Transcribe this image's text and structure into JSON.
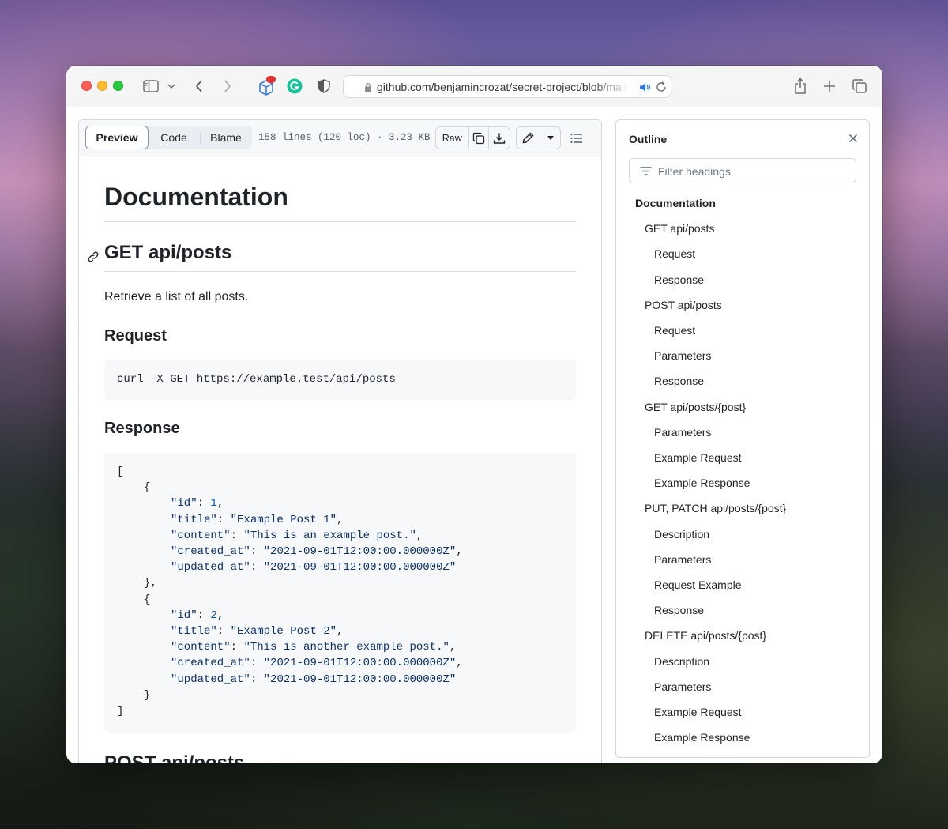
{
  "browser": {
    "url": "github.com/benjamincrozat/secret-project/blob/main",
    "extension_badge_count": "",
    "icons": [
      "sidebar-icon",
      "chevron-down-icon",
      "back-icon",
      "forward-icon",
      "extension-cube-icon",
      "grammarly-icon",
      "privacy-shield-icon",
      "lock-icon",
      "speaker-icon",
      "reload-icon",
      "share-icon",
      "new-tab-icon",
      "tab-overview-icon"
    ]
  },
  "file": {
    "tabs": [
      "Preview",
      "Code",
      "Blame"
    ],
    "active_tab": "Preview",
    "meta": "158 lines (120 loc) · 3.23 KB",
    "raw_label": "Raw"
  },
  "markdown": {
    "h1": "Documentation",
    "section1_title": "GET api/posts",
    "section1_desc": "Retrieve a list of all posts.",
    "request_heading": "Request",
    "request_code": "curl -X GET https://example.test/api/posts",
    "response_heading": "Response",
    "response_code": [
      {
        "indent": 0,
        "parts": [
          {
            "t": "p",
            "v": "["
          }
        ]
      },
      {
        "indent": 1,
        "parts": [
          {
            "t": "p",
            "v": "{"
          }
        ]
      },
      {
        "indent": 2,
        "parts": [
          {
            "t": "k",
            "v": "\"id\""
          },
          {
            "t": "p",
            "v": ": "
          },
          {
            "t": "n",
            "v": "1"
          },
          {
            "t": "p",
            "v": ","
          }
        ]
      },
      {
        "indent": 2,
        "parts": [
          {
            "t": "k",
            "v": "\"title\""
          },
          {
            "t": "p",
            "v": ": "
          },
          {
            "t": "k",
            "v": "\"Example Post 1\""
          },
          {
            "t": "p",
            "v": ","
          }
        ]
      },
      {
        "indent": 2,
        "parts": [
          {
            "t": "k",
            "v": "\"content\""
          },
          {
            "t": "p",
            "v": ": "
          },
          {
            "t": "k",
            "v": "\"This is an example post.\""
          },
          {
            "t": "p",
            "v": ","
          }
        ]
      },
      {
        "indent": 2,
        "parts": [
          {
            "t": "k",
            "v": "\"created_at\""
          },
          {
            "t": "p",
            "v": ": "
          },
          {
            "t": "k",
            "v": "\"2021-09-01T12:00:00.000000Z\""
          },
          {
            "t": "p",
            "v": ","
          }
        ]
      },
      {
        "indent": 2,
        "parts": [
          {
            "t": "k",
            "v": "\"updated_at\""
          },
          {
            "t": "p",
            "v": ": "
          },
          {
            "t": "k",
            "v": "\"2021-09-01T12:00:00.000000Z\""
          }
        ]
      },
      {
        "indent": 1,
        "parts": [
          {
            "t": "p",
            "v": "},"
          }
        ]
      },
      {
        "indent": 1,
        "parts": [
          {
            "t": "p",
            "v": "{"
          }
        ]
      },
      {
        "indent": 2,
        "parts": [
          {
            "t": "k",
            "v": "\"id\""
          },
          {
            "t": "p",
            "v": ": "
          },
          {
            "t": "n",
            "v": "2"
          },
          {
            "t": "p",
            "v": ","
          }
        ]
      },
      {
        "indent": 2,
        "parts": [
          {
            "t": "k",
            "v": "\"title\""
          },
          {
            "t": "p",
            "v": ": "
          },
          {
            "t": "k",
            "v": "\"Example Post 2\""
          },
          {
            "t": "p",
            "v": ","
          }
        ]
      },
      {
        "indent": 2,
        "parts": [
          {
            "t": "k",
            "v": "\"content\""
          },
          {
            "t": "p",
            "v": ": "
          },
          {
            "t": "k",
            "v": "\"This is another example post.\""
          },
          {
            "t": "p",
            "v": ","
          }
        ]
      },
      {
        "indent": 2,
        "parts": [
          {
            "t": "k",
            "v": "\"created_at\""
          },
          {
            "t": "p",
            "v": ": "
          },
          {
            "t": "k",
            "v": "\"2021-09-01T12:00:00.000000Z\""
          },
          {
            "t": "p",
            "v": ","
          }
        ]
      },
      {
        "indent": 2,
        "parts": [
          {
            "t": "k",
            "v": "\"updated_at\""
          },
          {
            "t": "p",
            "v": ": "
          },
          {
            "t": "k",
            "v": "\"2021-09-01T12:00:00.000000Z\""
          }
        ]
      },
      {
        "indent": 1,
        "parts": [
          {
            "t": "p",
            "v": "}"
          }
        ]
      },
      {
        "indent": 0,
        "parts": [
          {
            "t": "p",
            "v": "]"
          }
        ]
      }
    ],
    "next_section_title": "POST api/posts"
  },
  "outline": {
    "title": "Outline",
    "filter_placeholder": "Filter headings",
    "items": [
      {
        "label": "Documentation",
        "level": 1
      },
      {
        "label": "GET api/posts",
        "level": 2
      },
      {
        "label": "Request",
        "level": 3
      },
      {
        "label": "Response",
        "level": 3
      },
      {
        "label": "POST api/posts",
        "level": 2
      },
      {
        "label": "Request",
        "level": 3
      },
      {
        "label": "Parameters",
        "level": 3
      },
      {
        "label": "Response",
        "level": 3
      },
      {
        "label": "GET api/posts/{post}",
        "level": 2
      },
      {
        "label": "Parameters",
        "level": 3
      },
      {
        "label": "Example Request",
        "level": 3
      },
      {
        "label": "Example Response",
        "level": 3
      },
      {
        "label": "PUT, PATCH api/posts/{post}",
        "level": 2
      },
      {
        "label": "Description",
        "level": 3
      },
      {
        "label": "Parameters",
        "level": 3
      },
      {
        "label": "Request Example",
        "level": 3
      },
      {
        "label": "Response",
        "level": 3
      },
      {
        "label": "DELETE api/posts/{post}",
        "level": 2
      },
      {
        "label": "Description",
        "level": 3
      },
      {
        "label": "Parameters",
        "level": 3
      },
      {
        "label": "Example Request",
        "level": 3
      },
      {
        "label": "Example Response",
        "level": 3
      }
    ]
  },
  "colors": {
    "accent_text": "#1f2328",
    "code_string": "#0a3069",
    "code_number": "#0550ae",
    "border": "#d0d7de"
  }
}
